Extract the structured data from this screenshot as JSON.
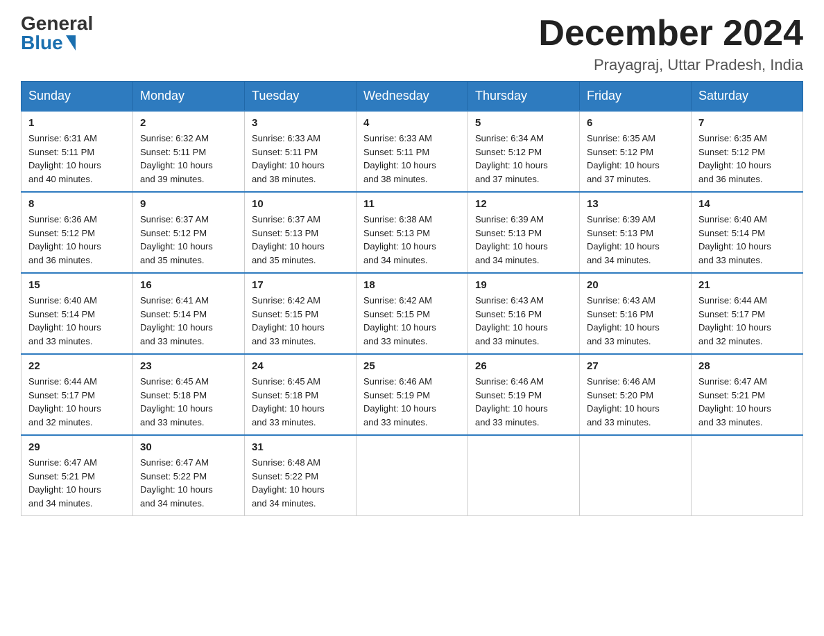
{
  "header": {
    "logo_general": "General",
    "logo_blue": "Blue",
    "month_title": "December 2024",
    "location": "Prayagraj, Uttar Pradesh, India"
  },
  "days_of_week": [
    "Sunday",
    "Monday",
    "Tuesday",
    "Wednesday",
    "Thursday",
    "Friday",
    "Saturday"
  ],
  "weeks": [
    [
      {
        "day": "1",
        "sunrise": "6:31 AM",
        "sunset": "5:11 PM",
        "daylight": "10 hours and 40 minutes."
      },
      {
        "day": "2",
        "sunrise": "6:32 AM",
        "sunset": "5:11 PM",
        "daylight": "10 hours and 39 minutes."
      },
      {
        "day": "3",
        "sunrise": "6:33 AM",
        "sunset": "5:11 PM",
        "daylight": "10 hours and 38 minutes."
      },
      {
        "day": "4",
        "sunrise": "6:33 AM",
        "sunset": "5:11 PM",
        "daylight": "10 hours and 38 minutes."
      },
      {
        "day": "5",
        "sunrise": "6:34 AM",
        "sunset": "5:12 PM",
        "daylight": "10 hours and 37 minutes."
      },
      {
        "day": "6",
        "sunrise": "6:35 AM",
        "sunset": "5:12 PM",
        "daylight": "10 hours and 37 minutes."
      },
      {
        "day": "7",
        "sunrise": "6:35 AM",
        "sunset": "5:12 PM",
        "daylight": "10 hours and 36 minutes."
      }
    ],
    [
      {
        "day": "8",
        "sunrise": "6:36 AM",
        "sunset": "5:12 PM",
        "daylight": "10 hours and 36 minutes."
      },
      {
        "day": "9",
        "sunrise": "6:37 AM",
        "sunset": "5:12 PM",
        "daylight": "10 hours and 35 minutes."
      },
      {
        "day": "10",
        "sunrise": "6:37 AM",
        "sunset": "5:13 PM",
        "daylight": "10 hours and 35 minutes."
      },
      {
        "day": "11",
        "sunrise": "6:38 AM",
        "sunset": "5:13 PM",
        "daylight": "10 hours and 34 minutes."
      },
      {
        "day": "12",
        "sunrise": "6:39 AM",
        "sunset": "5:13 PM",
        "daylight": "10 hours and 34 minutes."
      },
      {
        "day": "13",
        "sunrise": "6:39 AM",
        "sunset": "5:13 PM",
        "daylight": "10 hours and 34 minutes."
      },
      {
        "day": "14",
        "sunrise": "6:40 AM",
        "sunset": "5:14 PM",
        "daylight": "10 hours and 33 minutes."
      }
    ],
    [
      {
        "day": "15",
        "sunrise": "6:40 AM",
        "sunset": "5:14 PM",
        "daylight": "10 hours and 33 minutes."
      },
      {
        "day": "16",
        "sunrise": "6:41 AM",
        "sunset": "5:14 PM",
        "daylight": "10 hours and 33 minutes."
      },
      {
        "day": "17",
        "sunrise": "6:42 AM",
        "sunset": "5:15 PM",
        "daylight": "10 hours and 33 minutes."
      },
      {
        "day": "18",
        "sunrise": "6:42 AM",
        "sunset": "5:15 PM",
        "daylight": "10 hours and 33 minutes."
      },
      {
        "day": "19",
        "sunrise": "6:43 AM",
        "sunset": "5:16 PM",
        "daylight": "10 hours and 33 minutes."
      },
      {
        "day": "20",
        "sunrise": "6:43 AM",
        "sunset": "5:16 PM",
        "daylight": "10 hours and 33 minutes."
      },
      {
        "day": "21",
        "sunrise": "6:44 AM",
        "sunset": "5:17 PM",
        "daylight": "10 hours and 32 minutes."
      }
    ],
    [
      {
        "day": "22",
        "sunrise": "6:44 AM",
        "sunset": "5:17 PM",
        "daylight": "10 hours and 32 minutes."
      },
      {
        "day": "23",
        "sunrise": "6:45 AM",
        "sunset": "5:18 PM",
        "daylight": "10 hours and 33 minutes."
      },
      {
        "day": "24",
        "sunrise": "6:45 AM",
        "sunset": "5:18 PM",
        "daylight": "10 hours and 33 minutes."
      },
      {
        "day": "25",
        "sunrise": "6:46 AM",
        "sunset": "5:19 PM",
        "daylight": "10 hours and 33 minutes."
      },
      {
        "day": "26",
        "sunrise": "6:46 AM",
        "sunset": "5:19 PM",
        "daylight": "10 hours and 33 minutes."
      },
      {
        "day": "27",
        "sunrise": "6:46 AM",
        "sunset": "5:20 PM",
        "daylight": "10 hours and 33 minutes."
      },
      {
        "day": "28",
        "sunrise": "6:47 AM",
        "sunset": "5:21 PM",
        "daylight": "10 hours and 33 minutes."
      }
    ],
    [
      {
        "day": "29",
        "sunrise": "6:47 AM",
        "sunset": "5:21 PM",
        "daylight": "10 hours and 34 minutes."
      },
      {
        "day": "30",
        "sunrise": "6:47 AM",
        "sunset": "5:22 PM",
        "daylight": "10 hours and 34 minutes."
      },
      {
        "day": "31",
        "sunrise": "6:48 AM",
        "sunset": "5:22 PM",
        "daylight": "10 hours and 34 minutes."
      },
      null,
      null,
      null,
      null
    ]
  ],
  "labels": {
    "sunrise": "Sunrise:",
    "sunset": "Sunset:",
    "daylight": "Daylight:"
  }
}
